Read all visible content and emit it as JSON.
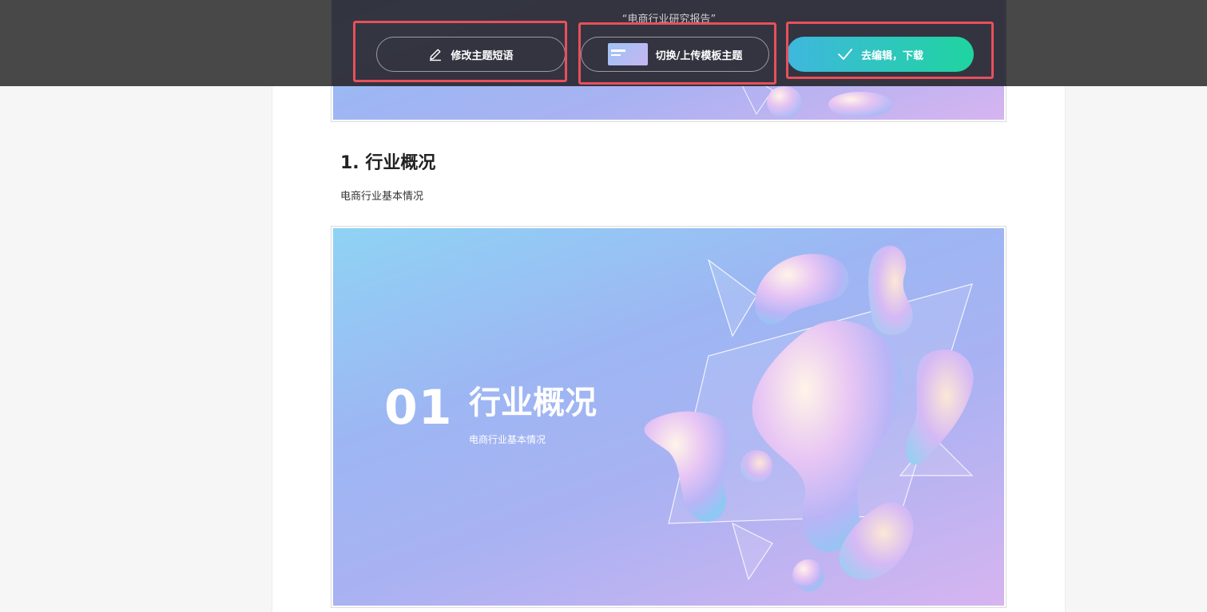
{
  "toolbar": {
    "doc_title": "“电商行业研究报告”",
    "edit_slogan_label": "修改主题短语",
    "switch_template_label": "切换/上传模板主题",
    "edit_download_label": "去编辑，下载"
  },
  "document": {
    "section_heading": "1. 行业概况",
    "section_subtitle": "电商行业基本情况"
  },
  "slide": {
    "number": "01",
    "title": "行业概况",
    "subtitle": "电商行业基本情况"
  },
  "colors": {
    "primary_gradient_start": "#3fb7de",
    "primary_gradient_end": "#1fd4a0",
    "highlight_box": "#e8505b",
    "toolbar_bg": "#3a3a3a"
  },
  "icons": {
    "edit_slogan": "pencil-icon",
    "switch_template": "template-thumbnail",
    "edit_download": "check-icon"
  }
}
